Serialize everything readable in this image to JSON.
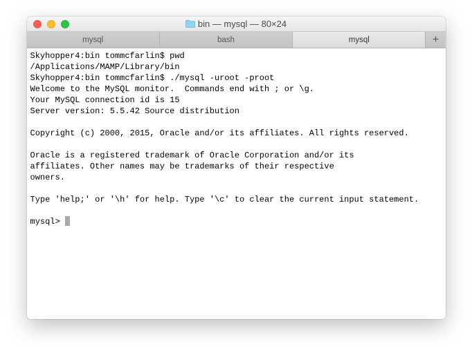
{
  "window": {
    "title": "bin — mysql — 80×24"
  },
  "tabs": [
    {
      "label": "mysql",
      "active": false
    },
    {
      "label": "bash",
      "active": false
    },
    {
      "label": "mysql",
      "active": true
    }
  ],
  "terminal": {
    "lines": [
      "Skyhopper4:bin tommcfarlin$ pwd",
      "/Applications/MAMP/Library/bin",
      "Skyhopper4:bin tommcfarlin$ ./mysql -uroot -proot",
      "Welcome to the MySQL monitor.  Commands end with ; or \\g.",
      "Your MySQL connection id is 15",
      "Server version: 5.5.42 Source distribution",
      "",
      "Copyright (c) 2000, 2015, Oracle and/or its affiliates. All rights reserved.",
      "",
      "Oracle is a registered trademark of Oracle Corporation and/or its",
      "affiliates. Other names may be trademarks of their respective",
      "owners.",
      "",
      "Type 'help;' or '\\h' for help. Type '\\c' to clear the current input statement.",
      ""
    ],
    "prompt": "mysql> "
  }
}
